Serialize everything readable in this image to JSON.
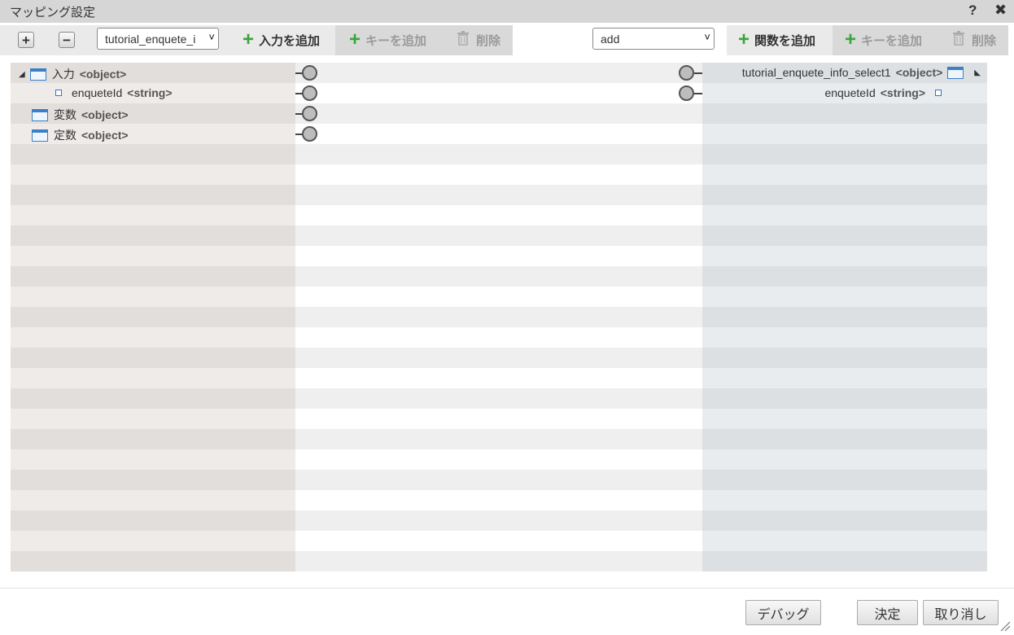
{
  "window": {
    "title": "マッピング設定",
    "help": "?",
    "close": "✖"
  },
  "toolbar": {
    "expand_all": "+",
    "collapse_all": "−",
    "input_select": "tutorial_enquete_i",
    "add_input": "入力を追加",
    "add_key_left": "キーを追加",
    "delete_left": "削除",
    "function_select": "add",
    "add_function": "関数を追加",
    "add_key_right": "キーを追加",
    "delete_right": "削除"
  },
  "left_tree": [
    {
      "label": "入力",
      "type": "<object>"
    },
    {
      "label": "enqueteId",
      "type": "<string>"
    },
    {
      "label": "変数",
      "type": "<object>"
    },
    {
      "label": "定数",
      "type": "<object>"
    }
  ],
  "right_tree": [
    {
      "label": "tutorial_enquete_info_select1",
      "type": "<object>"
    },
    {
      "label": "enqueteId",
      "type": "<string>"
    }
  ],
  "footer": {
    "debug": "デバッグ",
    "ok": "決定",
    "cancel": "取り消し"
  },
  "colors": {
    "add_icon": "#3aa63a",
    "object_icon": "#3b7fc7",
    "string_icon": "#3b6fd6"
  }
}
